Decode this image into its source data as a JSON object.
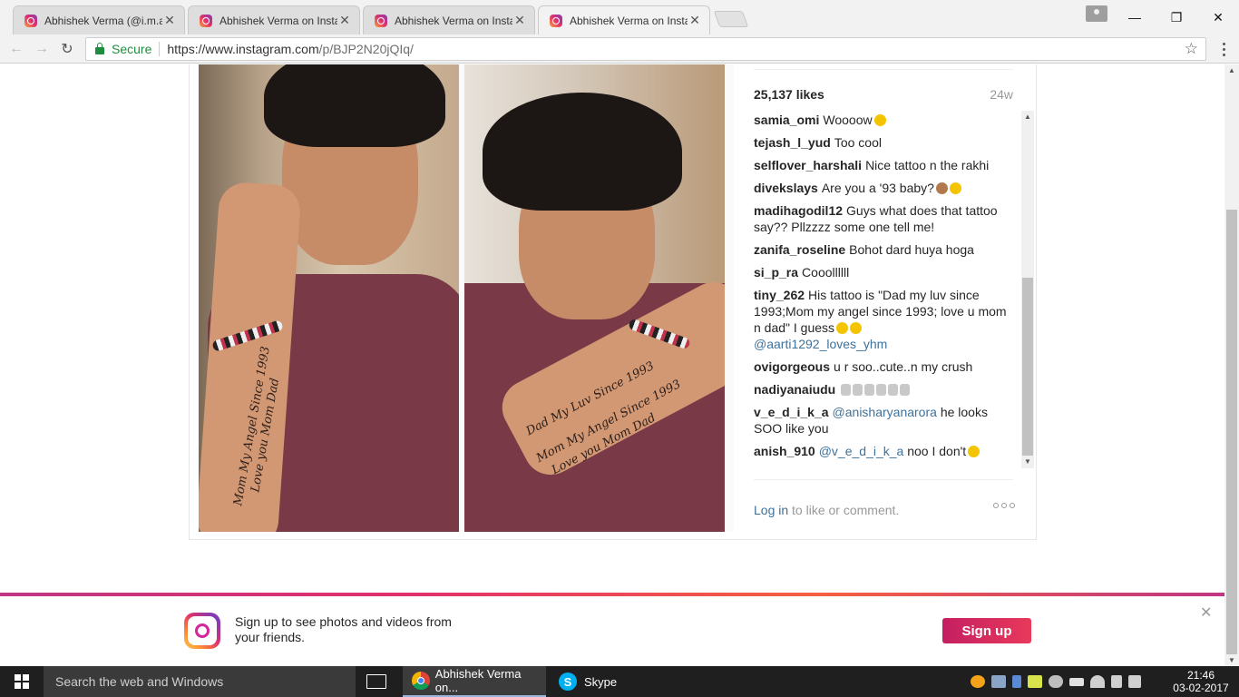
{
  "browser": {
    "tabs": [
      {
        "title": "Abhishek Verma (@i.m.al"
      },
      {
        "title": "Abhishek Verma on Insta"
      },
      {
        "title": "Abhishek Verma on Insta"
      },
      {
        "title": "Abhishek Verma on Insta"
      }
    ],
    "active_tab": 3,
    "secure_label": "Secure",
    "url_base": "https://www.instagram.com",
    "url_path": "/p/BJP2N20jQIq/"
  },
  "post": {
    "likes": "25,137 likes",
    "age": "24w",
    "comments": [
      {
        "user": "samia_omi",
        "text": "Woooow",
        "emoji": "face"
      },
      {
        "user": "tejash_l_yud",
        "text": "Too cool"
      },
      {
        "user": "selflover_harshali",
        "text": "Nice tattoo n the rakhi"
      },
      {
        "user": "divekslays",
        "text": "Are you a '93 baby?",
        "emoji": "monkey-heart-eyes"
      },
      {
        "user": "madihagodil12",
        "text": "Guys what does that tattoo say?? Pllzzzz some one tell me!"
      },
      {
        "user": "zanifa_roseline",
        "text": "Bohot dard huya hoga"
      },
      {
        "user": "si_p_ra",
        "text": "Cooollllll"
      },
      {
        "user": "tiny_262",
        "text": "His tattoo is \"Dad my luv since 1993;Mom my angel since 1993; love u mom n dad\" I guess",
        "emoji": "tongue-faces",
        "mention_after": "@aarti1292_loves_yhm"
      },
      {
        "user": "ovigorgeous",
        "text": "u r soo..cute..n my crush"
      },
      {
        "user": "nadiyanaiudu",
        "text": "",
        "emoji": "waving-hands"
      },
      {
        "user": "v_e_d_i_k_a",
        "mention": "@anisharyanarora",
        "text": "he looks SOO like you"
      },
      {
        "user": "anish_910",
        "mention": "@v_e_d_i_k_a",
        "text": "noo I don't",
        "emoji": "face"
      }
    ],
    "login_link": "Log in",
    "login_rest": "to like or comment.",
    "tattoo_left": [
      "Mom My Angel Since 1993",
      "Love you Mom Dad"
    ],
    "tattoo_right": [
      "Dad My Luv Since 1993",
      "Mom My Angel Since 1993",
      "Love you Mom Dad"
    ]
  },
  "banner": {
    "text": "Sign up to see photos and videos from your friends.",
    "signup_label": "Sign up",
    "colors": {
      "signup": "#d6245b"
    }
  },
  "taskbar": {
    "search_placeholder": "Search the web and Windows",
    "apps": [
      {
        "label": "Abhishek Verma on..."
      },
      {
        "label": "Skype"
      }
    ],
    "time": "21:46",
    "date": "03-02-2017"
  }
}
